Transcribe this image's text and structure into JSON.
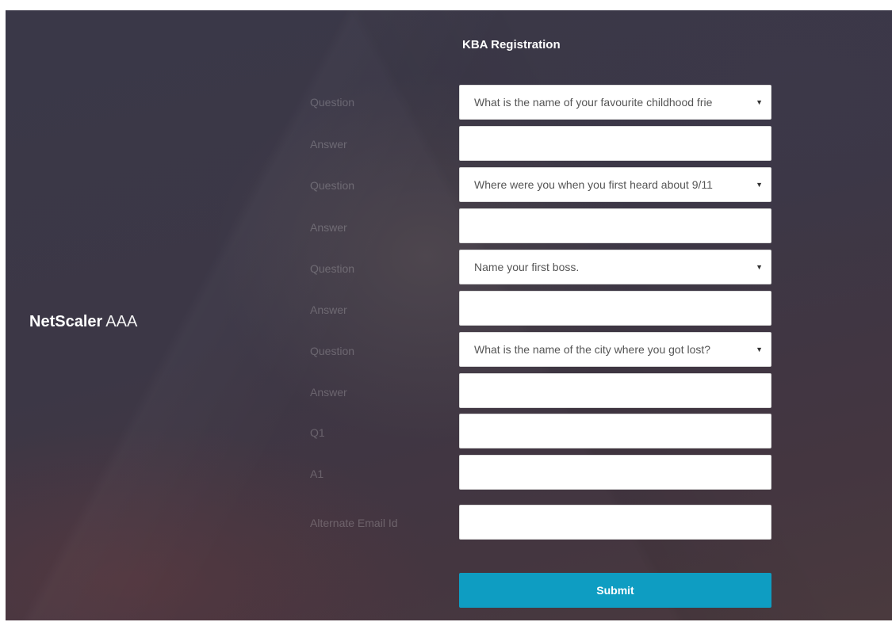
{
  "brand": {
    "name_bold": "NetScaler",
    "name_light": "AAA"
  },
  "form": {
    "title": "KBA Registration",
    "rows": [
      {
        "label": "Question",
        "type": "select",
        "value": "What is the name of your favourite childhood frie"
      },
      {
        "label": "Answer",
        "type": "input",
        "value": ""
      },
      {
        "label": "Question",
        "type": "select",
        "value": "Where were you when you first heard about 9/11"
      },
      {
        "label": "Answer",
        "type": "input",
        "value": ""
      },
      {
        "label": "Question",
        "type": "select",
        "value": "Name your first boss."
      },
      {
        "label": "Answer",
        "type": "input",
        "value": ""
      },
      {
        "label": "Question",
        "type": "select",
        "value": "What is the name of the city where you got lost?"
      },
      {
        "label": "Answer",
        "type": "input",
        "value": ""
      },
      {
        "label": "Q1",
        "type": "input",
        "value": ""
      },
      {
        "label": "A1",
        "type": "input",
        "value": ""
      },
      {
        "label": "Alternate Email Id",
        "type": "input",
        "value": ""
      }
    ],
    "submit_label": "Submit"
  },
  "colors": {
    "submit_bg": "#0e9dc2",
    "page_bg": "#3c3746"
  },
  "icons": {
    "dropdown": "triangle-down-icon"
  }
}
